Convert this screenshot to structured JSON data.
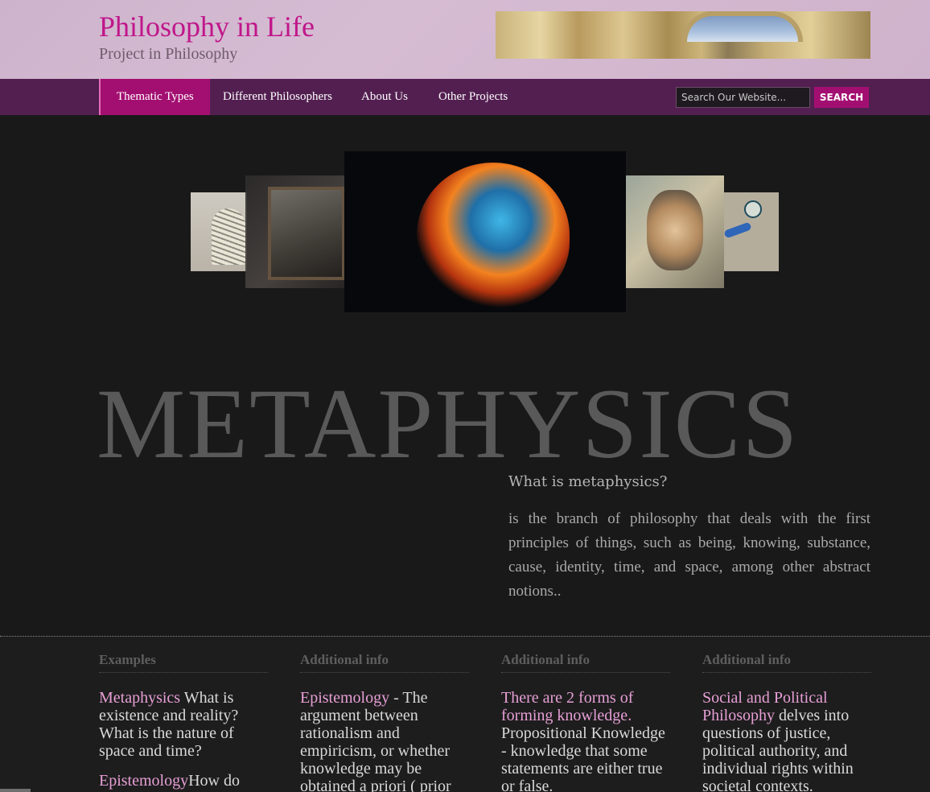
{
  "header": {
    "title": "Philosophy in Life",
    "tagline": "Project in Philosophy"
  },
  "nav": {
    "items": [
      "Thematic Types",
      "Different Philosophers",
      "About Us",
      "Other Projects"
    ],
    "active_index": 0,
    "search_placeholder": "Search Our Website...",
    "search_button": "SEARCH"
  },
  "hero": {
    "heading": "METAPHYSICS",
    "question": "What is metaphysics?",
    "definition": "is the branch of philosophy that deals with the first principles of things, such as being, knowing, substance, cause, identity, time, and space, among other abstract notions.."
  },
  "columns": [
    {
      "heading": "Examples",
      "paragraphs": [
        {
          "link": "Metaphysics",
          "text": " What is existence and reality? What is the nature of space and time?"
        },
        {
          "link": "Epistemology",
          "text": "How do"
        }
      ]
    },
    {
      "heading": "Additional info",
      "paragraphs": [
        {
          "link": "Epistemology",
          "text": " - The argument between rationalism and empiricism, or whether knowledge may be obtained a priori ( prior"
        }
      ]
    },
    {
      "heading": "Additional info",
      "paragraphs": [
        {
          "link": "There are 2 forms of forming knowledge.",
          "text": " Propositional Knowledge - knowledge that some statements are either true or false."
        }
      ]
    },
    {
      "heading": "Additional info",
      "paragraphs": [
        {
          "link": "Social and Political Philosophy",
          "text": " delves into questions of justice, political authority, and individual rights within societal contexts."
        }
      ]
    }
  ],
  "colors": {
    "brand": "#c0168a",
    "nav_bg": "#531f51",
    "nav_active": "#a30f71",
    "link": "#e79fd6"
  }
}
